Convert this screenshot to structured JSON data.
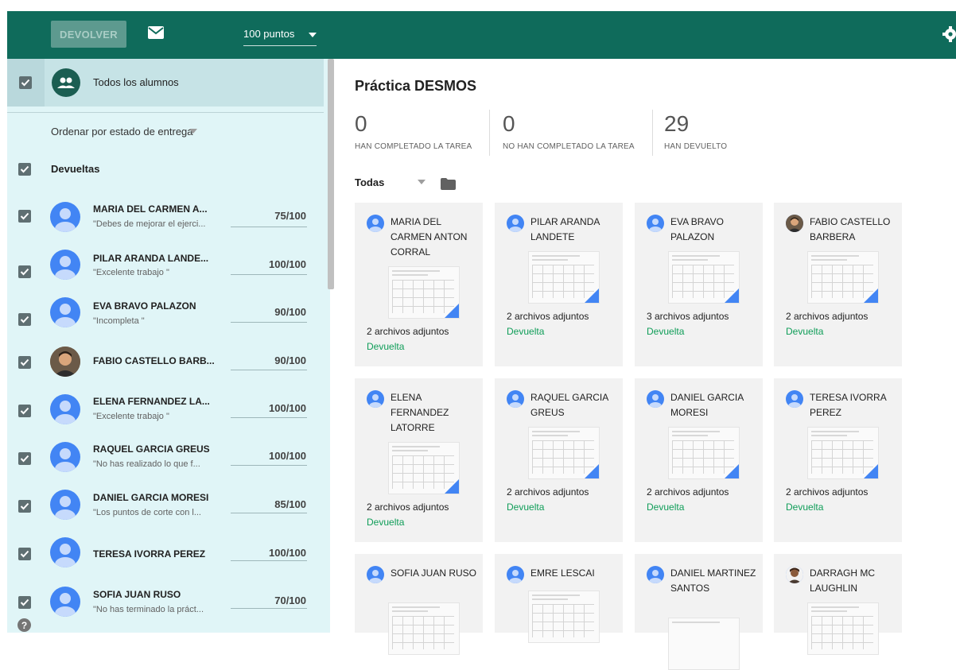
{
  "toolbar": {
    "return_label": "DEVOLVER",
    "points_value": "100 puntos",
    "icons": [
      "mail-icon",
      "dropdown-caret-icon",
      "gear-icon"
    ],
    "accent_color": "#0f6b5b"
  },
  "sidebar": {
    "all_students_label": "Todos los alumnos",
    "sort_label": "Ordenar por estado de entrega",
    "section_label": "Devueltas",
    "students": [
      {
        "name": "MARIA DEL CARMEN A...",
        "comment": "\"Debes de mejorar el ejerci...",
        "grade": "75/100"
      },
      {
        "name": "PILAR ARANDA LANDE...",
        "comment": "\"Excelente trabajo \"",
        "grade": "100/100"
      },
      {
        "name": "EVA BRAVO PALAZON",
        "comment": "\"Incompleta \"",
        "grade": "90/100"
      },
      {
        "name": "FABIO CASTELLO BARB...",
        "comment": "",
        "grade": "90/100"
      },
      {
        "name": "ELENA FERNANDEZ LA...",
        "comment": "\"Excelente trabajo \"",
        "grade": "100/100"
      },
      {
        "name": "RAQUEL GARCIA GREUS",
        "comment": "\"No has realizado lo que f...",
        "grade": "100/100"
      },
      {
        "name": "DANIEL GARCIA MORESI",
        "comment": "\"Los puntos de corte con l...",
        "grade": "85/100"
      },
      {
        "name": "TERESA IVORRA PEREZ",
        "comment": "",
        "grade": "100/100"
      },
      {
        "name": "SOFIA JUAN RUSO",
        "comment": "\"No has terminado la práct...",
        "grade": "70/100"
      }
    ]
  },
  "main": {
    "title": "Práctica DESMOS",
    "stats": [
      {
        "value": "0",
        "label": "HAN COMPLETADO LA TAREA"
      },
      {
        "value": "0",
        "label": "NO HAN COMPLETADO LA TAREA"
      },
      {
        "value": "29",
        "label": "HAN DEVUELTO"
      }
    ],
    "filter_label": "Todas",
    "cards": [
      {
        "name": "MARIA DEL CARMEN ANTON CORRAL",
        "files": "2 archivos adjuntos",
        "status": "Devuelta"
      },
      {
        "name": "PILAR ARANDA LANDETE",
        "files": "2 archivos adjuntos",
        "status": "Devuelta"
      },
      {
        "name": "EVA BRAVO PALAZON",
        "files": "3 archivos adjuntos",
        "status": "Devuelta"
      },
      {
        "name": "FABIO CASTELLO BARBERA",
        "files": "2 archivos adjuntos",
        "status": "Devuelta"
      },
      {
        "name": "ELENA FERNANDEZ LATORRE",
        "files": "2 archivos adjuntos",
        "status": "Devuelta"
      },
      {
        "name": "RAQUEL GARCIA GREUS",
        "files": "2 archivos adjuntos",
        "status": "Devuelta"
      },
      {
        "name": "DANIEL GARCIA MORESI",
        "files": "2 archivos adjuntos",
        "status": "Devuelta"
      },
      {
        "name": "TERESA IVORRA PEREZ",
        "files": "2 archivos adjuntos",
        "status": "Devuelta"
      },
      {
        "name": "SOFIA JUAN RUSO",
        "files": "",
        "status": ""
      },
      {
        "name": "EMRE LESCAI",
        "files": "",
        "status": ""
      },
      {
        "name": "DANIEL MARTINEZ SANTOS",
        "files": "",
        "status": ""
      },
      {
        "name": "DARRAGH MC LAUGHLIN",
        "files": "",
        "status": ""
      }
    ],
    "status_color": "#0f9d58"
  }
}
